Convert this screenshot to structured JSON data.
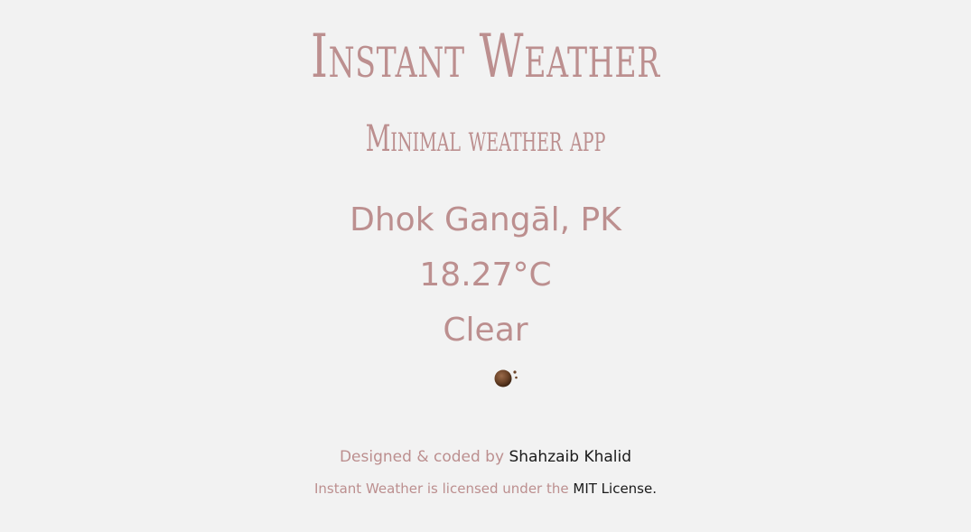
{
  "header": {
    "title": "Instant Weather",
    "subtitle": "Minimal weather app"
  },
  "weather": {
    "location": "Dhok Gangāl, PK",
    "temperature": "18.27°C",
    "condition": "Clear",
    "icon": "clear-night-moon-icon"
  },
  "footer": {
    "credit_prefix": "Designed & coded by ",
    "author_link": "Shahzaib Khalid",
    "license_prefix": "Instant Weather is licensed under the ",
    "license_link": "MIT License",
    "license_suffix": "."
  },
  "colors": {
    "background": "#f2f2f2",
    "accent": "#bc8f8f",
    "link": "#1a1a1a"
  }
}
